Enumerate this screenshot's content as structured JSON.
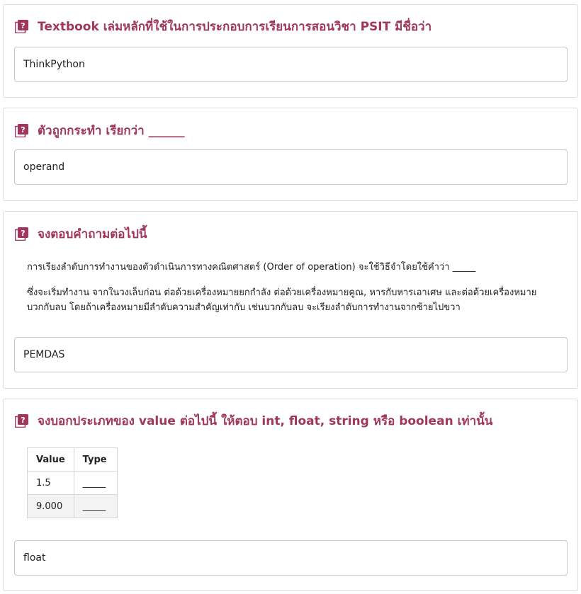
{
  "questions": [
    {
      "title": "Textbook เล่มหลักที่ใช้ในการประกอบการเรียนการสอนวิชา PSIT มีชื่อว่า",
      "answer": "ThinkPython"
    },
    {
      "title": "ตัวถูกกระทำ เรียกว่า ______",
      "answer": "operand"
    },
    {
      "title": "จงตอบคำถามต่อไปนี้",
      "text_1": "การเรียงลำดับการทำงานของตัวดำเนินการทางคณิตศาสตร์ (Order of operation) จะใช้วิธีจำโดยใช้คำว่า _____",
      "text_2": "ซึ่งจะเริ่มทำงาน จากในวงเล็บก่อน ต่อด้วยเครื่องหมายยกกำลัง ต่อด้วยเครื่องหมายคูณ, หารกับหารเอาเศษ และต่อด้วยเครื่องหมายบวกกับลบ โดยถ้าเครื่องหมายมีลำดับความสำคัญเท่ากับ เช่นบวกกับลบ จะเรียงลำดับการทำงานจากซ้ายไปขวา",
      "answer": "PEMDAS"
    },
    {
      "title": "จงบอกประเภทของ value ต่อไปนี้ ให้ตอบ int, float, string หรือ boolean เท่านั้น",
      "table": {
        "headers": [
          "Value",
          "Type"
        ],
        "rows": [
          [
            "1.5",
            "_____"
          ],
          [
            "9.000",
            "_____"
          ]
        ]
      },
      "answer": "float"
    }
  ],
  "icon": "question-book-icon",
  "colors": {
    "accent": "#a0365e",
    "border": "#dcdcdc"
  }
}
